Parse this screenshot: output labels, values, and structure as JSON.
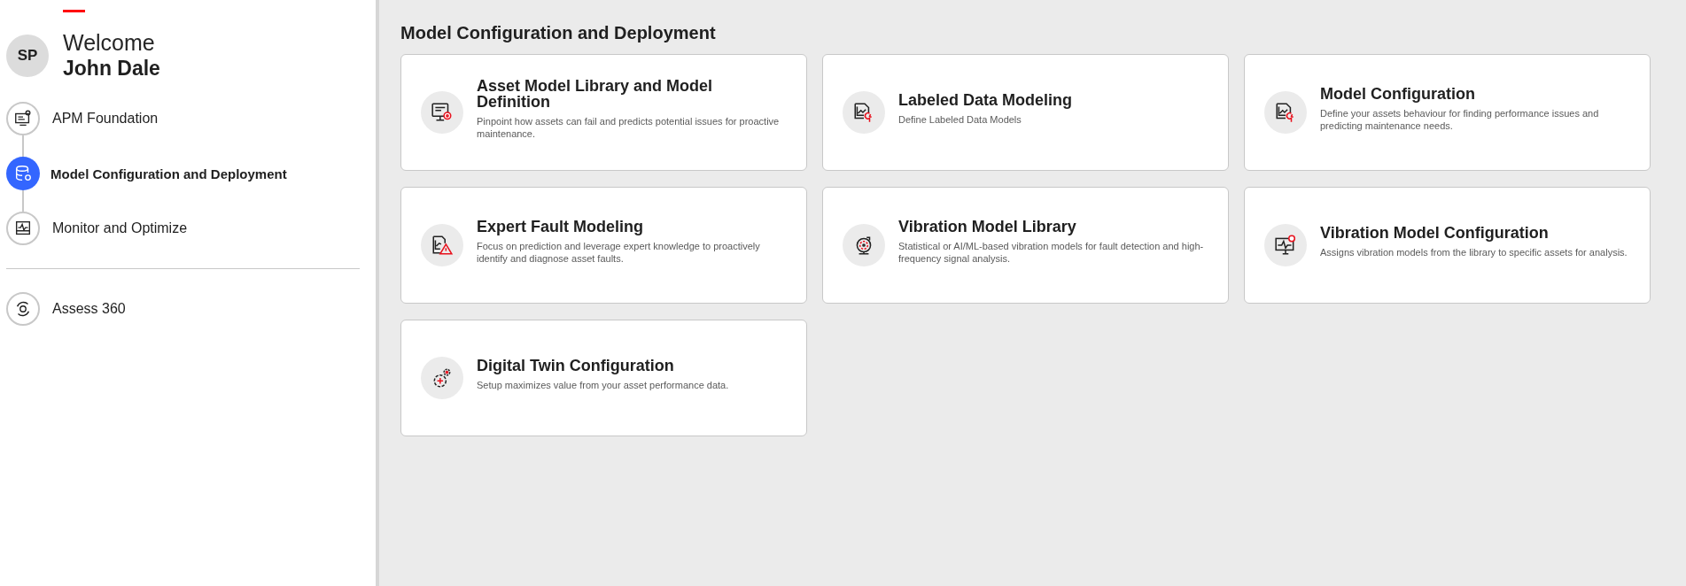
{
  "user": {
    "initials": "SP",
    "greeting": "Welcome",
    "name": "John Dale"
  },
  "steps": [
    {
      "label": "APM Foundation",
      "selected": false
    },
    {
      "label": "Model Configuration and Deployment",
      "selected": true
    },
    {
      "label": "Monitor and Optimize",
      "selected": false
    }
  ],
  "links": [
    {
      "label": "Assess 360"
    }
  ],
  "main": {
    "title": "Model Configuration and Deployment",
    "cards": [
      {
        "title": "Asset Model Library and Model Definition",
        "description": "Pinpoint how assets can fail and predicts potential issues for proactive maintenance."
      },
      {
        "title": "Labeled Data Modeling",
        "description": "Define Labeled Data Models"
      },
      {
        "title": "Model Configuration",
        "description": "Define your assets behaviour for finding performance issues and predicting maintenance needs."
      },
      {
        "title": "Expert Fault Modeling",
        "description": "Focus on prediction and leverage expert knowledge to proactively identify and diagnose asset faults."
      },
      {
        "title": "Vibration Model Library",
        "description": "Statistical or AI/ML-based vibration models for fault detection and high-frequency signal analysis."
      },
      {
        "title": "Vibration Model Configuration",
        "description": "Assigns vibration models from the library to specific assets for analysis."
      },
      {
        "title": "Digital Twin Configuration",
        "description": "Setup maximizes value from your asset performance data."
      }
    ]
  }
}
